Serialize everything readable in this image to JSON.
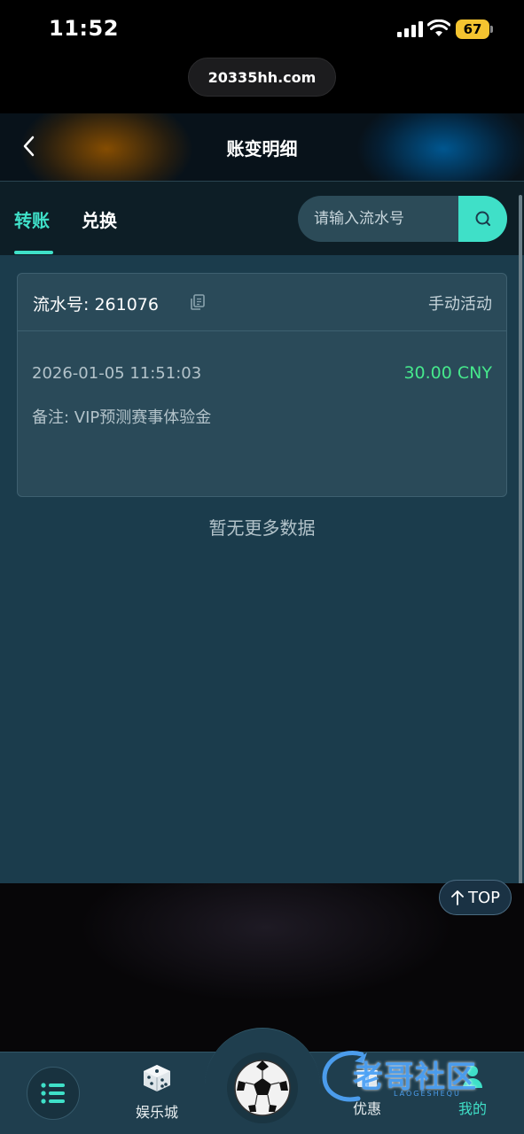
{
  "status_bar": {
    "time": "11:52",
    "battery": "67"
  },
  "browser": {
    "url": "20335hh.com"
  },
  "header": {
    "title": "账变明细"
  },
  "tabs": [
    {
      "label": "转账",
      "active": true
    },
    {
      "label": "兑换",
      "active": false
    }
  ],
  "search": {
    "placeholder": "请输入流水号",
    "value": ""
  },
  "records": [
    {
      "serial": "流水号: 261076",
      "type": "手动活动",
      "datetime": "2026-01-05 11:51:03",
      "amount": "30.00 CNY",
      "remark": "备注: VIP预测赛事体验金"
    }
  ],
  "no_more_text": "暂无更多数据",
  "top_button": {
    "label": "TOP"
  },
  "bottom_nav": {
    "items": [
      {
        "label": "娱乐城",
        "icon": "dice-icon"
      },
      {
        "label": "优惠",
        "icon": "gift-icon"
      },
      {
        "label": "我的",
        "icon": "user-icon"
      }
    ]
  },
  "watermark": {
    "text": "老哥社区",
    "sub": "LAOGESHEQU"
  },
  "colors": {
    "accent": "#3fe0c8",
    "amount_green": "#46e88c",
    "content_bg": "#1b3c4c"
  }
}
